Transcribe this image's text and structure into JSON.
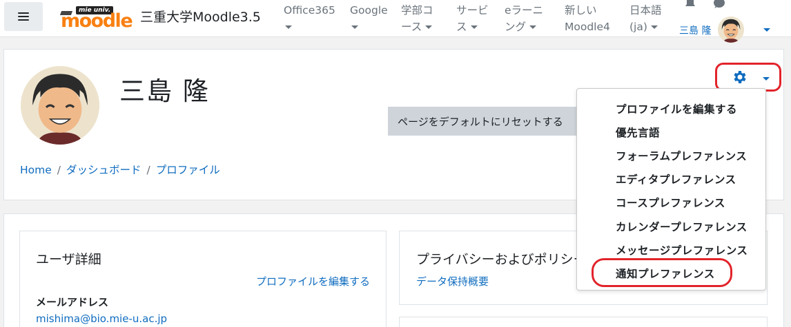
{
  "navbar": {
    "site_name": "三重大学Moodle3.5",
    "logo_univ": "mie univ.",
    "logo_text": "moodle",
    "menu": [
      {
        "line1": "Office365",
        "line2": ""
      },
      {
        "line1": "Google",
        "line2": ""
      },
      {
        "line1": "学部コ",
        "line2": "ース"
      },
      {
        "line1": "サービ",
        "line2": "ス"
      },
      {
        "line1": "eラーニ",
        "line2": "ング"
      },
      {
        "line1": "新しい",
        "line2": "Moodle4"
      },
      {
        "line1": "日本語",
        "line2": "(ja)"
      }
    ],
    "user_name": "三島 隆"
  },
  "header": {
    "profile_name": "三島 隆",
    "breadcrumb": [
      "Home",
      "ダッシュボード",
      "プロファイル"
    ],
    "reset_button": "ページをデフォルトにリセットする"
  },
  "dropdown": {
    "items": [
      "プロファイルを編集する",
      "優先言語",
      "フォーラムプレファレンス",
      "エディタプレファレンス",
      "コースプレファレンス",
      "カレンダープレファレンス",
      "メッセージプレファレンス",
      "通知プレファレンス"
    ]
  },
  "user_details": {
    "title": "ユーザ詳細",
    "edit_link": "プロファイルを編集する",
    "email_label": "メールアドレス",
    "email": "mishima@bio.mie-u.ac.jp"
  },
  "privacy": {
    "title": "プライバシーおよびポリシー",
    "link": "データ保持概要"
  },
  "colors": {
    "link": "#0f6cbf",
    "highlight": "#e2232a",
    "brand": "#f98012"
  }
}
